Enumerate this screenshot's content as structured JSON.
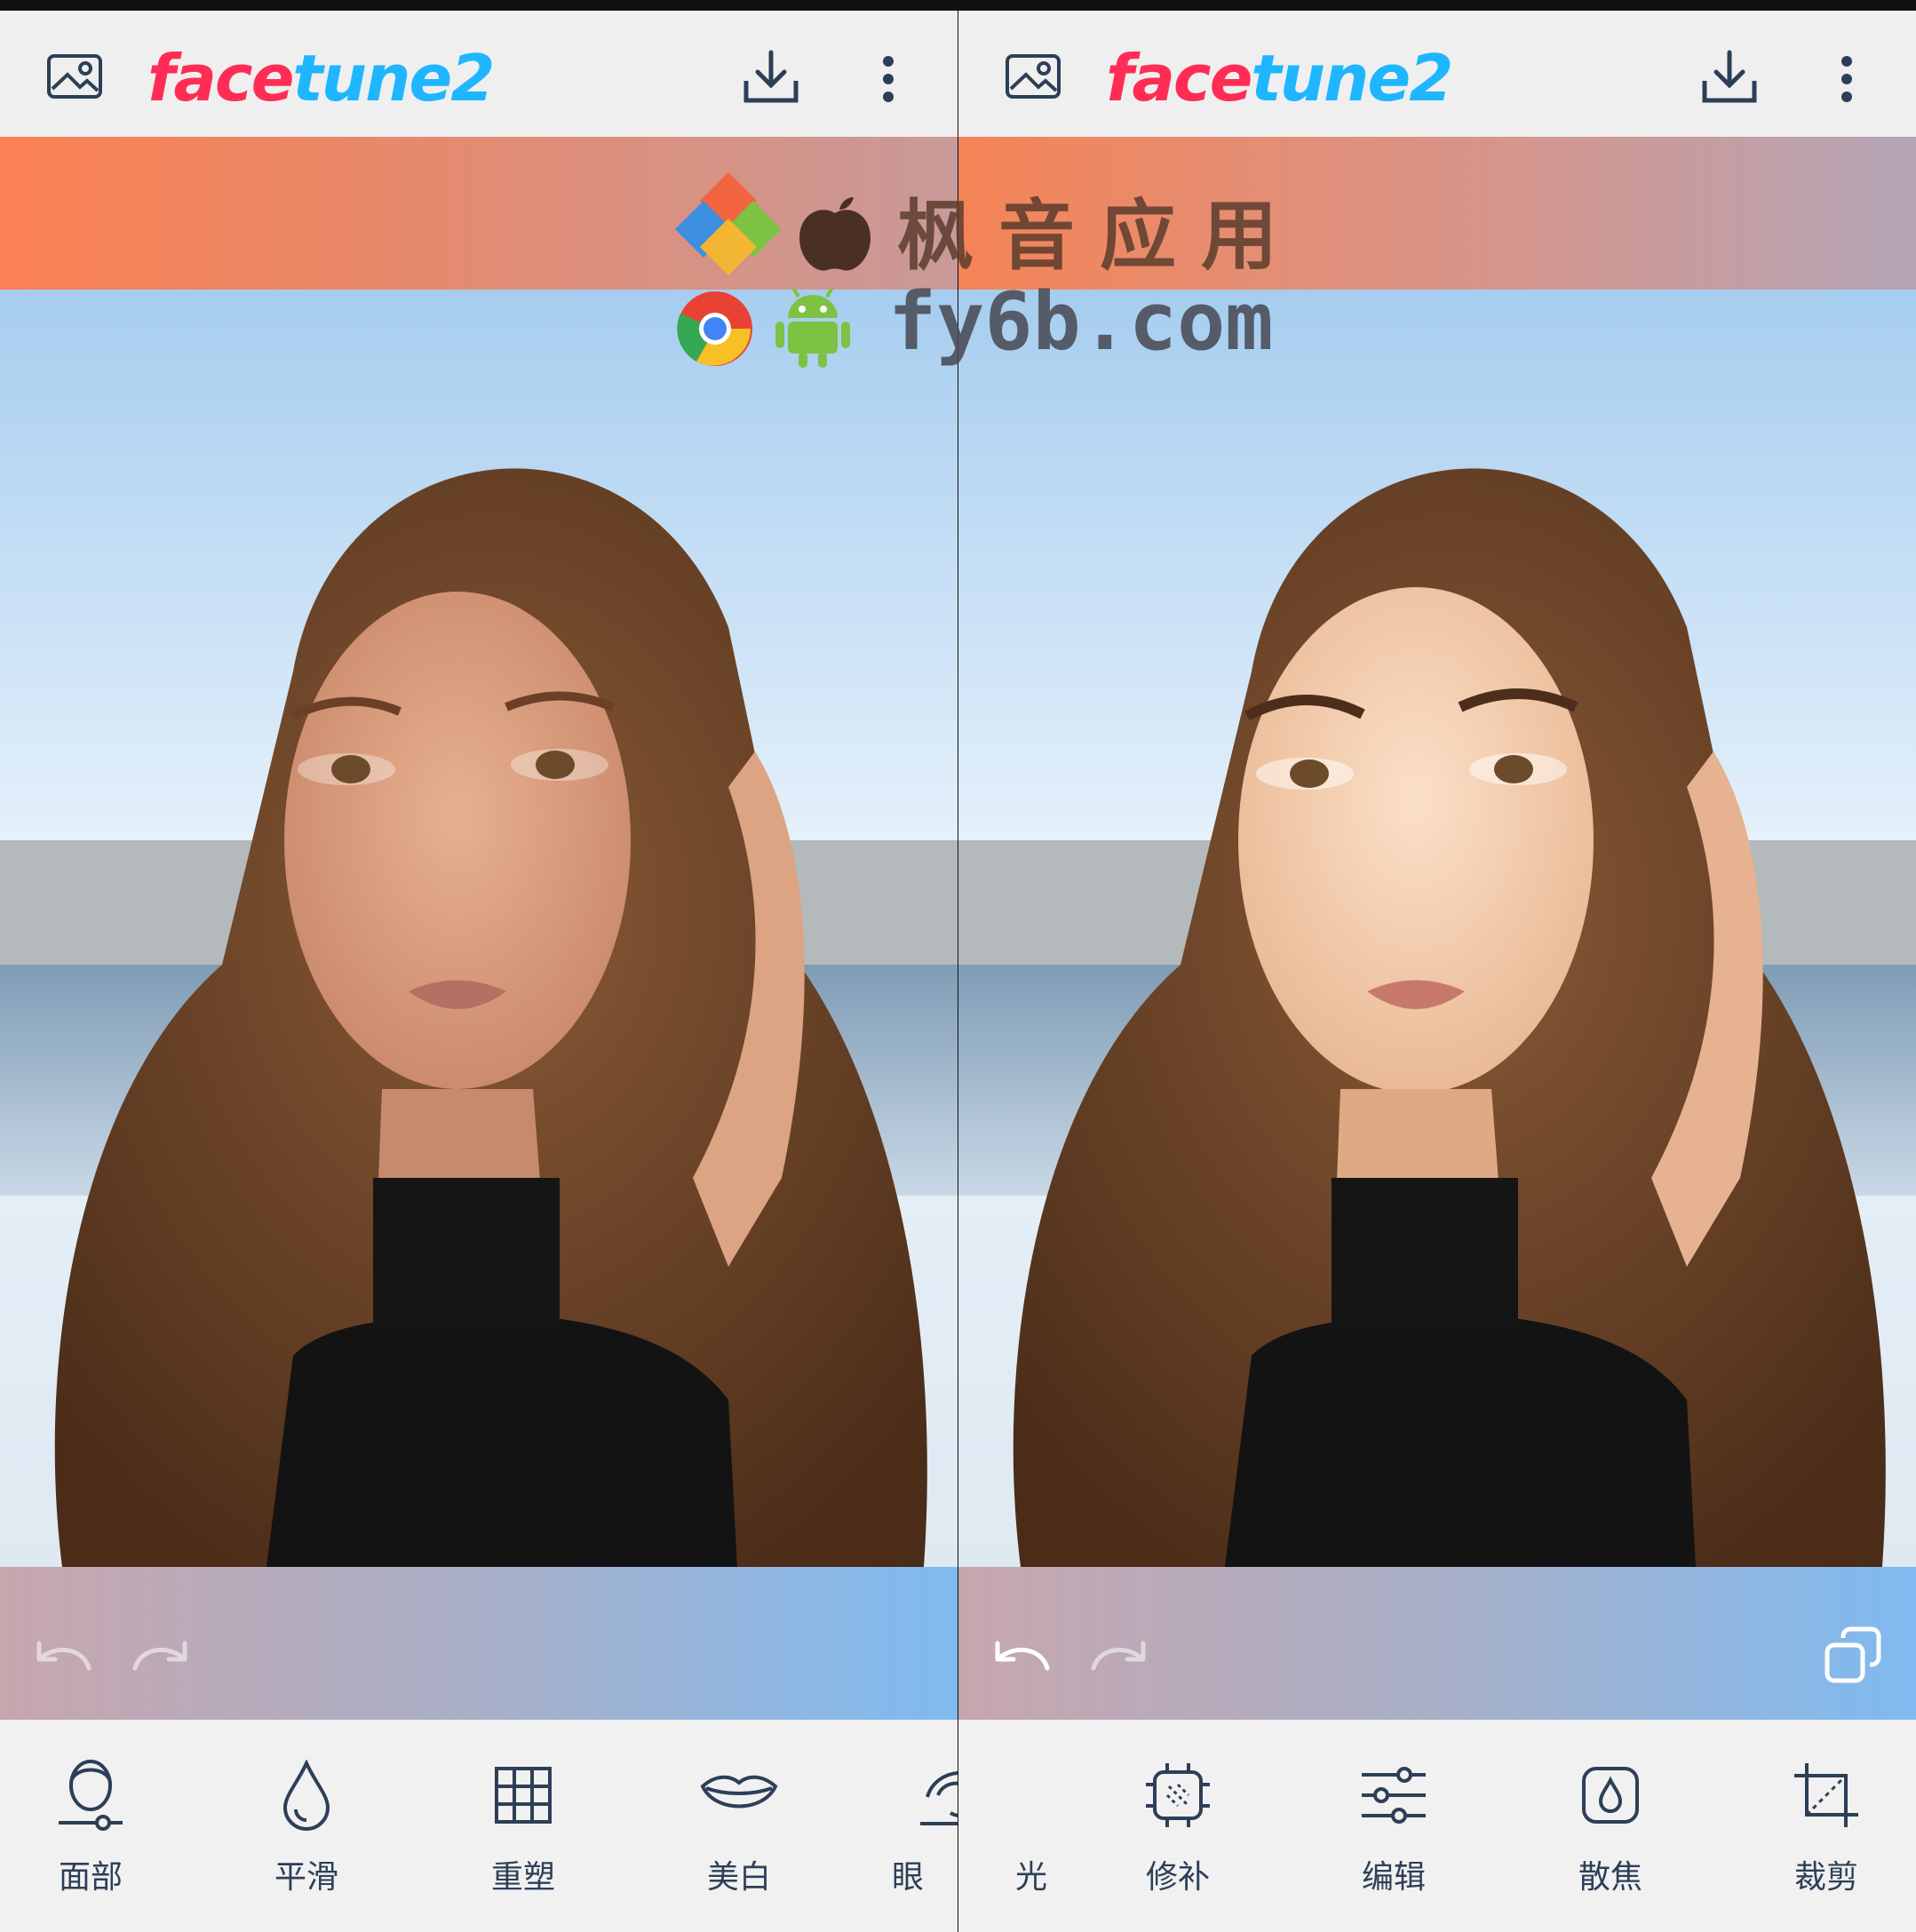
{
  "app": {
    "logo_part1": "face",
    "logo_part2": "tune2",
    "brand_colors": {
      "face": "#ff2d55",
      "tune": "#1fb6ff"
    }
  },
  "header": {
    "icons": [
      "gallery-icon",
      "download-icon",
      "more-vertical-icon"
    ]
  },
  "left_panel": {
    "tools": [
      {
        "id": "face",
        "label": "面部",
        "icon": "face-icon"
      },
      {
        "id": "smooth",
        "label": "平滑",
        "icon": "droplet-icon"
      },
      {
        "id": "reshape",
        "label": "重塑",
        "icon": "grid-icon"
      },
      {
        "id": "whiten",
        "label": "美白",
        "icon": "lips-icon"
      }
    ]
  },
  "split_tool": {
    "label_left": "眼",
    "label_right": "光",
    "icon": "eye-light-icon"
  },
  "right_panel": {
    "tools": [
      {
        "id": "patch",
        "label": "修补",
        "icon": "patch-icon"
      },
      {
        "id": "edit",
        "label": "编辑",
        "icon": "sliders-icon"
      },
      {
        "id": "defocus",
        "label": "散焦",
        "icon": "defocus-icon"
      },
      {
        "id": "crop",
        "label": "裁剪",
        "icon": "crop-icon"
      }
    ]
  },
  "watermark": {
    "line1": "枫音应用",
    "line2": "fy6b.com"
  }
}
